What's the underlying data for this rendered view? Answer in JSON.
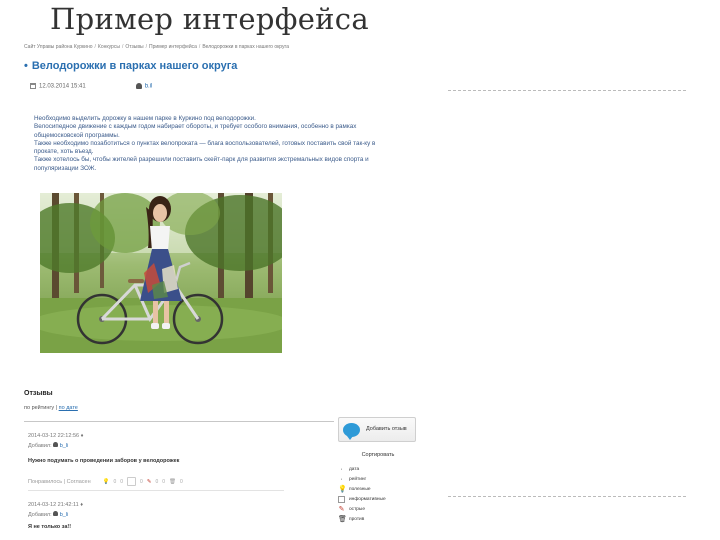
{
  "slide": {
    "title": "Пример интерфейса"
  },
  "breadcrumb": [
    "Сайт Управы района Куркино",
    "Конкурсы",
    "Отзывы",
    "Пример интерфейса",
    "Велодорожки в парках нашего округа"
  ],
  "article": {
    "title": "Велодорожки в парках нашего округа",
    "date": "12.03.2014 15:41",
    "author": "b.il",
    "body": [
      "Необходимо выделить дорожку в нашем парке в Куркино под велодорожки.",
      "Велосипедное движение с каждым годом набирает обороты, и требует особого внимания, особенно в рамках общемосковской программы.",
      "Также необходимо позаботиться о пунктах велопроката — блага воспользователей, готовых поставить свой так-ку в прокате, хоть въезд.",
      "Также хотелось бы, чтобы жителей разрешили поставить скейт-парк для развития экстремальных видов спорта и популяризации ЗОЖ."
    ]
  },
  "reviews": {
    "title": "Отзывы",
    "sort_label": "по рейтингу",
    "sort_link": "по дате",
    "comments": [
      {
        "date": "2014-03-12 22:12:56 ♦",
        "author_prefix": "Добавил:",
        "author": "b_li",
        "text": "Нужно подумать о проведении заборов у велодорожек",
        "footer_label": "Понравилось | Согласен",
        "counts": [
          "0",
          "0",
          "0",
          "0",
          "0",
          "0"
        ]
      },
      {
        "date": "2014-03-12 21:42:11 ♦",
        "author_prefix": "Добавил:",
        "author": "b_li",
        "text": "Я не только за!!"
      }
    ]
  },
  "side": {
    "add_button": "Добавить отзыв",
    "sort_title": "Сортировать",
    "sort_items": [
      "дата",
      "рейтинг",
      "полезные",
      "информативные",
      "острые",
      "против"
    ]
  },
  "colors": {
    "link": "#2a6fb0",
    "bubble": "#2e9ad7"
  }
}
